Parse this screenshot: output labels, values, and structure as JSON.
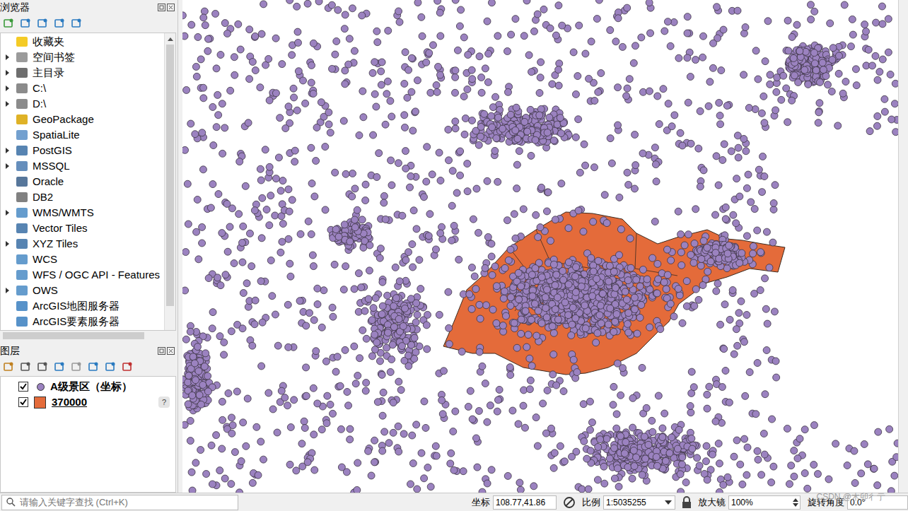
{
  "browser": {
    "title": "浏览器",
    "items": [
      {
        "label": "收藏夹",
        "expandable": false
      },
      {
        "label": "空间书签",
        "expandable": true
      },
      {
        "label": "主目录",
        "expandable": true
      },
      {
        "label": "C:\\",
        "expandable": true
      },
      {
        "label": "D:\\",
        "expandable": true
      },
      {
        "label": "GeoPackage",
        "expandable": false
      },
      {
        "label": "SpatiaLite",
        "expandable": false
      },
      {
        "label": "PostGIS",
        "expandable": true
      },
      {
        "label": "MSSQL",
        "expandable": true
      },
      {
        "label": "Oracle",
        "expandable": false
      },
      {
        "label": "DB2",
        "expandable": false
      },
      {
        "label": "WMS/WMTS",
        "expandable": true
      },
      {
        "label": "Vector Tiles",
        "expandable": false
      },
      {
        "label": "XYZ Tiles",
        "expandable": true
      },
      {
        "label": "WCS",
        "expandable": false
      },
      {
        "label": "WFS / OGC API - Features",
        "expandable": false
      },
      {
        "label": "OWS",
        "expandable": true
      },
      {
        "label": "ArcGIS地图服务器",
        "expandable": false
      },
      {
        "label": "ArcGIS要素服务器",
        "expandable": false
      }
    ]
  },
  "layers": {
    "title": "图层",
    "items": [
      {
        "label": "A级景区（坐标）",
        "checked": true,
        "kind": "point",
        "color": "#9b82c0",
        "underlined": false,
        "badge": ""
      },
      {
        "label": "370000",
        "checked": true,
        "kind": "polygon",
        "color": "#e46b3a",
        "underlined": true,
        "badge": "?"
      }
    ]
  },
  "status_bar": {
    "search_placeholder": "请输入关键字查找 (Ctrl+K)",
    "coordinate_label": "坐标",
    "coordinate": "108.77,41.86",
    "scale_label": "比例",
    "scale": "1:5035255",
    "magnifier_label": "放大镜",
    "magnifier": "100%",
    "rotation_label": "旋转角度",
    "rotation": "0.0°"
  },
  "watermark": "CSDN @木卯彳亍"
}
